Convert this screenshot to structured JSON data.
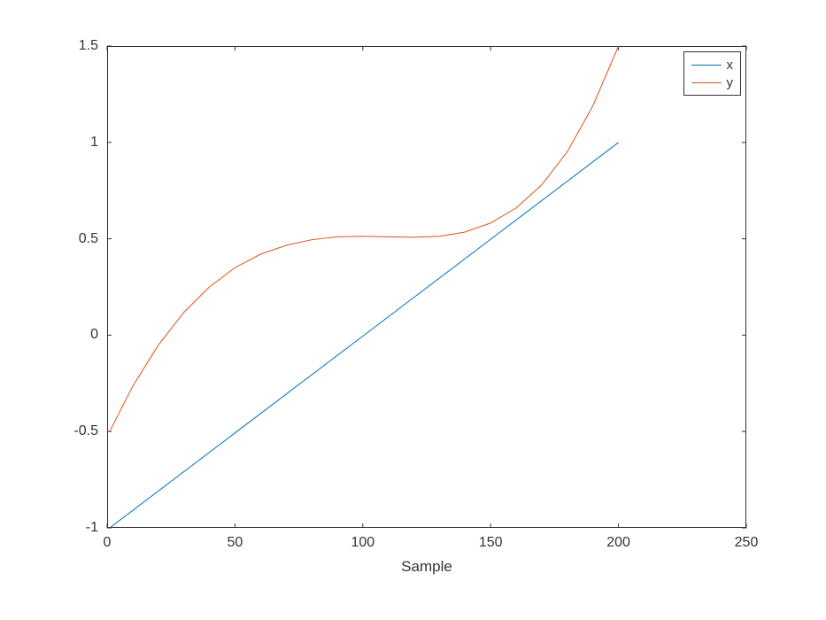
{
  "chart_data": {
    "type": "line",
    "xlabel": "Sample",
    "ylabel": "",
    "xlim": [
      0,
      250
    ],
    "ylim": [
      -1,
      1.5
    ],
    "xticks": [
      0,
      50,
      100,
      150,
      200,
      250
    ],
    "yticks": [
      -1,
      -0.5,
      0,
      0.5,
      1,
      1.5
    ],
    "legend_position": "top-right",
    "series": [
      {
        "name": "x",
        "color": "#0072BD",
        "x": [
          1,
          50,
          100,
          150,
          200
        ],
        "y": [
          -1,
          -0.5075,
          -0.005,
          0.4975,
          1
        ]
      },
      {
        "name": "y",
        "color": "#D95319",
        "x": [
          1,
          10,
          20,
          30,
          40,
          50,
          60,
          70,
          80,
          90,
          100,
          110,
          120,
          130,
          140,
          150,
          160,
          170,
          180,
          190,
          200
        ],
        "y": [
          -0.5,
          -0.265,
          -0.052,
          0.118,
          0.25,
          0.35,
          0.42,
          0.466,
          0.495,
          0.51,
          0.513,
          0.51,
          0.508,
          0.513,
          0.535,
          0.582,
          0.66,
          0.78,
          0.952,
          1.19,
          1.5
        ]
      }
    ]
  }
}
